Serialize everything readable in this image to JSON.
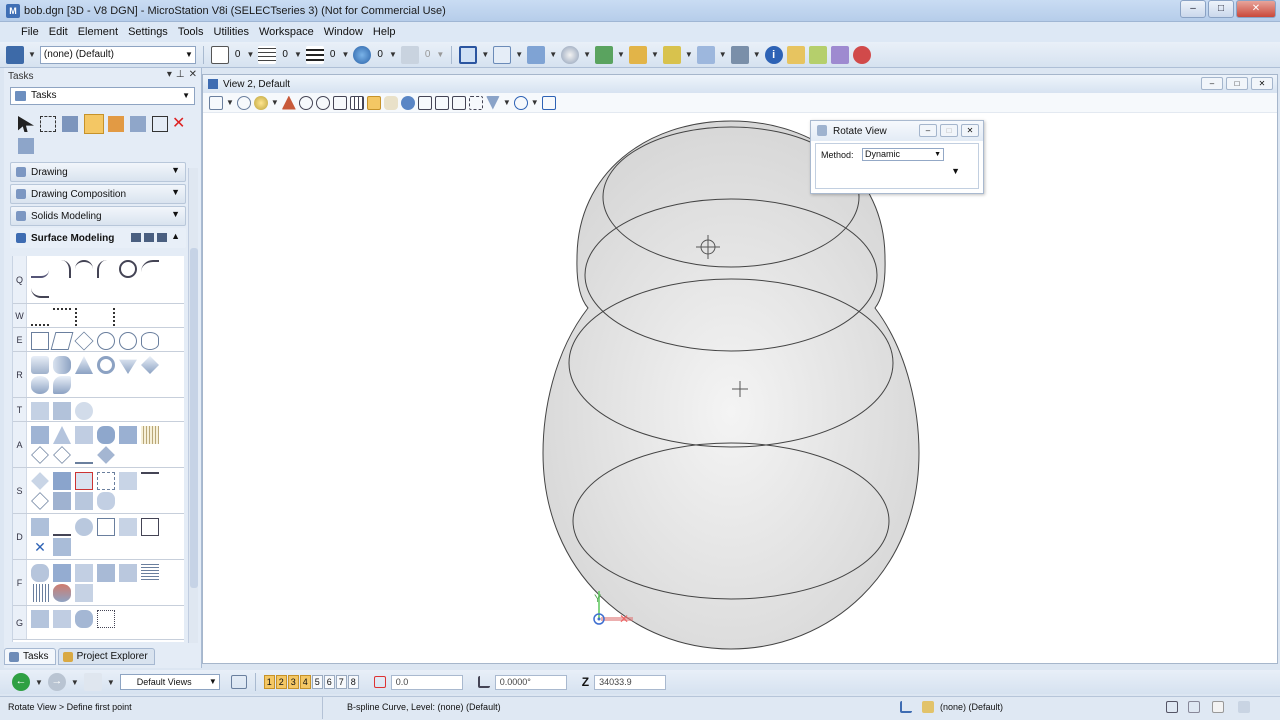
{
  "window": {
    "title": "bob.dgn [3D - V8 DGN] - MicroStation V8i (SELECTseries 3) (Not for Commercial Use)",
    "min_glyph": "–",
    "max_glyph": "□",
    "close_glyph": "✕"
  },
  "menu": [
    "File",
    "Edit",
    "Element",
    "Settings",
    "Tools",
    "Utilities",
    "Workspace",
    "Window",
    "Help"
  ],
  "toolbar": {
    "level_combo": "(none) (Default)",
    "color_value": "0",
    "line_style_value": "0",
    "line_weight_value": "0",
    "transparency_value": "0",
    "priority_value": "0"
  },
  "tasks_panel": {
    "header": "Tasks",
    "selector": "Tasks",
    "rows": [
      {
        "label": "Drawing"
      },
      {
        "label": "Drawing Composition"
      },
      {
        "label": "Solids Modeling"
      },
      {
        "label": "Surface Modeling"
      }
    ],
    "group_letters": [
      "Q",
      "W",
      "E",
      "R",
      "T",
      "A",
      "S",
      "D",
      "F",
      "G"
    ],
    "tabs": [
      "Tasks",
      "Project Explorer"
    ]
  },
  "view": {
    "title": "View 2, Default",
    "axis_y": "Y"
  },
  "rotate_dialog": {
    "title": "Rotate View",
    "method_label": "Method:",
    "method_value": "Dynamic"
  },
  "view_bar": {
    "views_combo": "Default Views",
    "view_numbers": [
      "1",
      "2",
      "3",
      "4",
      "5",
      "6",
      "7",
      "8"
    ],
    "active_views": [
      "1",
      "2",
      "3",
      "4"
    ],
    "x_field": "0.0",
    "angle_field": "0.0000°",
    "z_label": "Z",
    "z_field": "34033.9"
  },
  "status": {
    "prompt": "Rotate View > Define first point",
    "element_info": "B-spline Curve, Level: (none) (Default)",
    "active_level": "(none) (Default)"
  },
  "colors": {
    "accent": "#3e6cb2",
    "active_tool": "#f4c764",
    "close_red": "#c9483a",
    "nav_green": "#2fa043"
  }
}
